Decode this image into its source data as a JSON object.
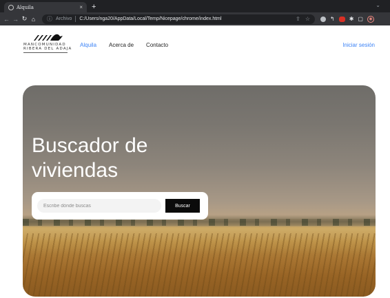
{
  "browser": {
    "tab_title": "Alquila",
    "tab_close": "×",
    "new_tab": "+",
    "scheme_label": "Archivo",
    "url": "C:/Users/nga20/AppData/Local/Temp/Nicepage/chrome/index.html"
  },
  "header": {
    "logo_line1": "MANCOMUNIDAD",
    "logo_line2": "RIBERA DEL ADAJA",
    "nav": [
      {
        "label": "Alquila",
        "active": true
      },
      {
        "label": "Acerca de",
        "active": false
      },
      {
        "label": "Contacto",
        "active": false
      }
    ],
    "login": "Iniciar sesión"
  },
  "hero": {
    "title_line1": "Buscador de",
    "title_line2": "viviendas",
    "search": {
      "placeholder": "Escribe dónde buscas",
      "button": "Buscar"
    }
  },
  "colors": {
    "accent": "#3b82f6",
    "button": "#0b0b0b"
  }
}
